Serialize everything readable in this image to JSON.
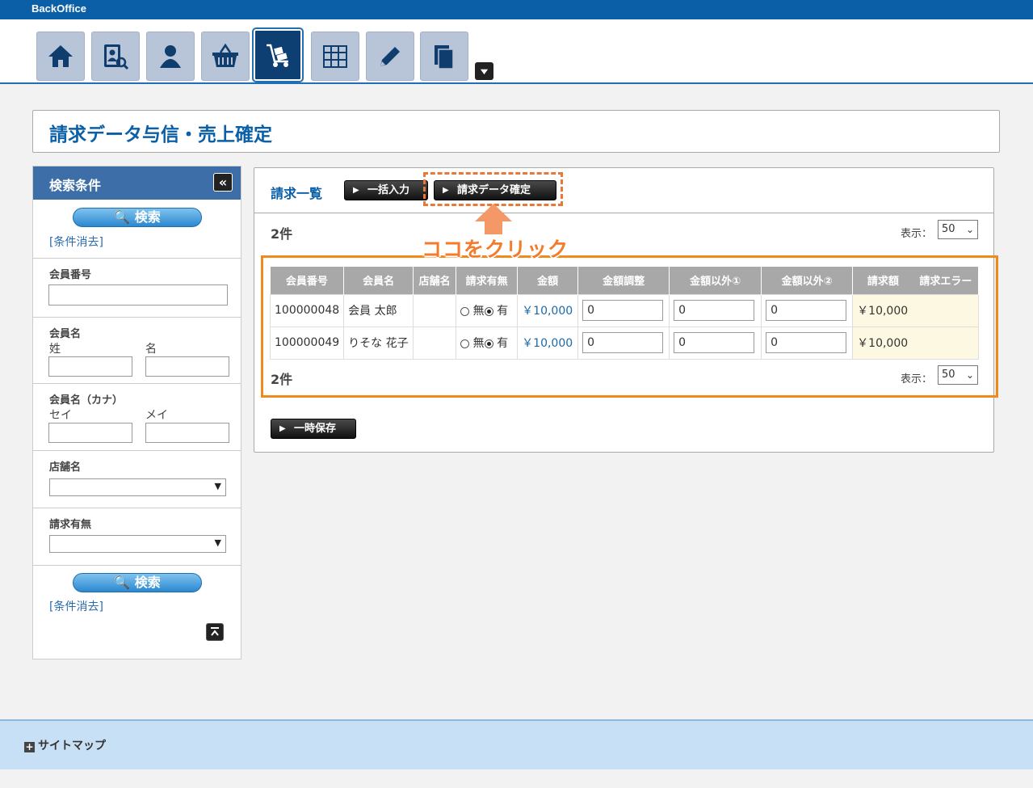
{
  "app": {
    "brand": "BackOffice"
  },
  "nav": {
    "items": [
      {
        "icon": "home-icon"
      },
      {
        "icon": "member-search-icon"
      },
      {
        "icon": "user-icon"
      },
      {
        "icon": "basket-icon"
      },
      {
        "icon": "cart-dolly-icon",
        "active": true
      },
      {
        "icon": "grid-icon"
      },
      {
        "icon": "pencil-icon"
      },
      {
        "icon": "documents-icon"
      }
    ]
  },
  "page": {
    "title": "請求データ与信・売上確定"
  },
  "sidebar": {
    "title": "検索条件",
    "search_label": "検索",
    "clear_label": "[条件消去]",
    "member_no_label": "会員番号",
    "member_name_label": "会員名",
    "last_name_label": "姓",
    "first_name_label": "名",
    "member_kana_label": "会員名（カナ）",
    "last_kana_label": "セイ",
    "first_kana_label": "メイ",
    "shop_label": "店舗名",
    "billing_label": "請求有無"
  },
  "main": {
    "heading": "請求一覧",
    "bulk_input_label": "一括入力",
    "confirm_label": "請求データ確定",
    "count_label": "2件",
    "display_label": "表示：",
    "display_value": "50",
    "save_label": "一時保存",
    "callout": "ココをクリック",
    "columns": [
      "会員番号",
      "会員名",
      "店舗名",
      "請求有無",
      "金額",
      "金額調整",
      "金額以外①",
      "金額以外②",
      "請求額",
      "請求エラー"
    ],
    "rows": [
      {
        "no": "100000048",
        "name": "会員 太郎",
        "shop": "",
        "off": "無",
        "on": "有",
        "amount": "￥10,000",
        "adj": "0",
        "other1": "0",
        "other2": "0",
        "billed": "￥10,000",
        "error": ""
      },
      {
        "no": "100000049",
        "name": "りそな 花子",
        "shop": "",
        "off": "無",
        "on": "有",
        "amount": "￥10,000",
        "adj": "0",
        "other1": "0",
        "other2": "0",
        "billed": "￥10,000",
        "error": ""
      }
    ]
  },
  "footer": {
    "sitemap_label": "サイトマップ"
  }
}
